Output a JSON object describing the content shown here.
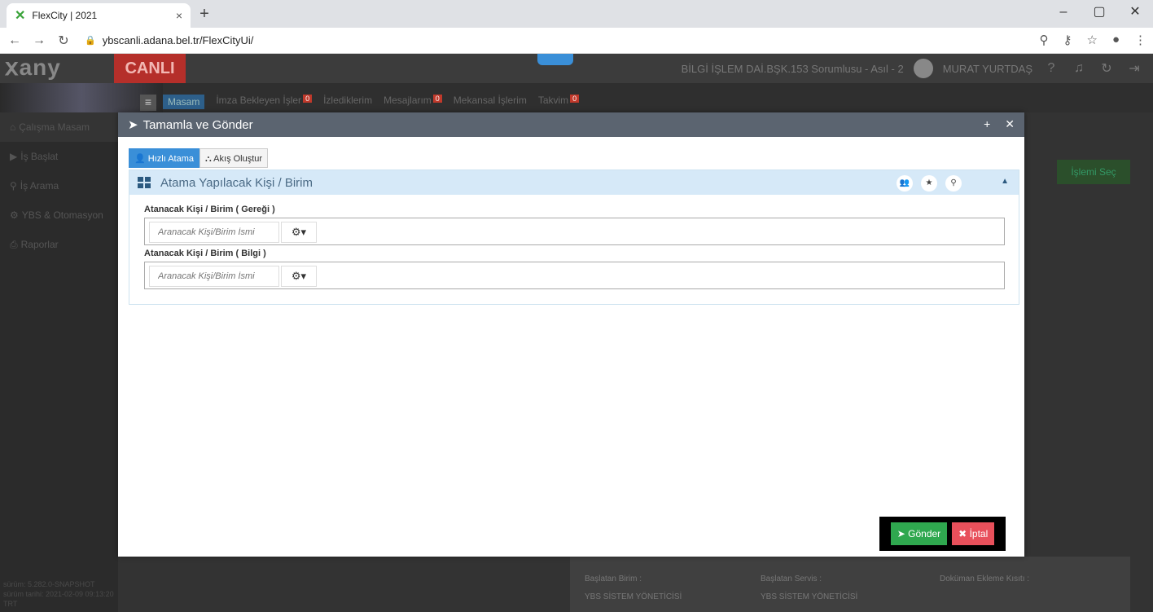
{
  "browser": {
    "tab_title": "FlexCity | 2021",
    "url": "ybscanli.adana.bel.tr/FlexCityUi/"
  },
  "header": {
    "env_badge": "CANLI",
    "role": "BİLGİ İŞLEM DAİ.BŞK.153 Sorumlusu - Asıl - 2",
    "user": "MURAT YURTDAŞ"
  },
  "nav": {
    "items": [
      {
        "label": "Masam",
        "badge": ""
      },
      {
        "label": "İmza Bekleyen İşler",
        "badge": "0"
      },
      {
        "label": "İzlediklerim",
        "badge": ""
      },
      {
        "label": "Mesajlarım",
        "badge": "0"
      },
      {
        "label": "Mekansal İşlerim",
        "badge": ""
      },
      {
        "label": "Takvim",
        "badge": "0"
      }
    ]
  },
  "sidebar": {
    "items": [
      {
        "label": "Çalışma Masam"
      },
      {
        "label": "İş Başlat"
      },
      {
        "label": "İş Arama"
      },
      {
        "label": "YBS & Otomasyon"
      },
      {
        "label": "Raporlar"
      }
    ],
    "version_line1": "sürüm: 5.282.0-SNAPSHOT",
    "version_line2": "sürüm tarihi: 2021-02-09 09:13:20 TRT"
  },
  "background": {
    "action_button": "İşlemi Seç",
    "baslatan_birim_label": "Başlatan Birim :",
    "baslatan_birim_value": "YBS SİSTEM YÖNETİCİSİ",
    "baslatan_servis_label": "Başlatan Servis :",
    "baslatan_servis_value": "YBS SİSTEM YÖNETİCİSİ",
    "dokuman_label": "Doküman Ekleme Kısıtı :"
  },
  "modal": {
    "title": "Tamamla ve Gönder",
    "tabs": [
      {
        "label": "Hızlı Atama"
      },
      {
        "label": "Akış Oluştur"
      }
    ],
    "panel_title": "Atama Yapılacak Kişi / Birim",
    "field1_label": "Atanacak Kişi / Birim ( Gereği )",
    "field2_label": "Atanacak Kişi / Birim ( Bilgi )",
    "input_placeholder": "Aranacak Kişi/Birim İsmi",
    "send_label": "Gönder",
    "cancel_label": "İptal"
  }
}
